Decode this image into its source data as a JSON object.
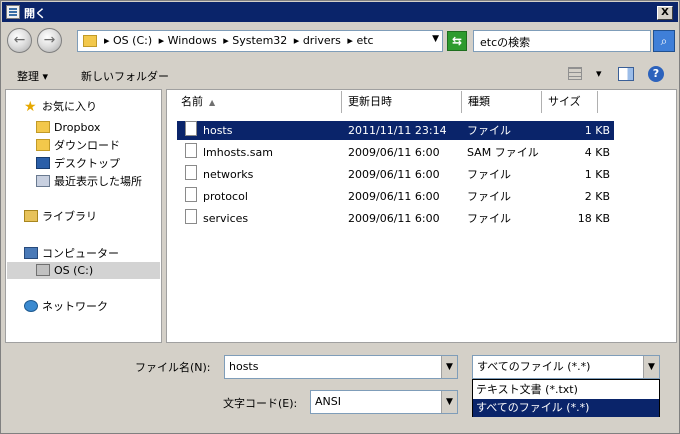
{
  "window": {
    "title": "開く",
    "close_label": "X"
  },
  "nav": {
    "back_label": "←",
    "forward_label": "→",
    "breadcrumbs": [
      "▸ OS (C:)",
      "▸ Windows",
      "▸ System32",
      "▸ drivers",
      "▸ etc"
    ],
    "refresh_label": "⇆",
    "search_placeholder": "etcの検索"
  },
  "toolbar": {
    "organize_label": "整理 ▾",
    "new_folder_label": "新しいフォルダー",
    "views_arrow": "▾",
    "help_label": "?"
  },
  "sidebar": {
    "favorites": "お気に入り",
    "items": [
      "Dropbox",
      "ダウンロード",
      "デスクトップ",
      "最近表示した場所"
    ],
    "libraries": "ライブラリ",
    "computer": "コンピューター",
    "drive": "OS (C:)",
    "network": "ネットワーク"
  },
  "columns": {
    "name": "名前",
    "date": "更新日時",
    "type": "種類",
    "size": "サイズ",
    "sort_arrow": "▲"
  },
  "files": [
    {
      "name": "hosts",
      "date": "2011/11/11 23:14",
      "type": "ファイル",
      "size": "1 KB"
    },
    {
      "name": "lmhosts.sam",
      "date": "2009/06/11 6:00",
      "type": "SAM ファイル",
      "size": "4 KB"
    },
    {
      "name": "networks",
      "date": "2009/06/11 6:00",
      "type": "ファイル",
      "size": "1 KB"
    },
    {
      "name": "protocol",
      "date": "2009/06/11 6:00",
      "type": "ファイル",
      "size": "2 KB"
    },
    {
      "name": "services",
      "date": "2009/06/11 6:00",
      "type": "ファイル",
      "size": "18 KB"
    }
  ],
  "bottom": {
    "filename_label": "ファイル名(N):",
    "filename_value": "hosts",
    "encoding_label": "文字コード(E):",
    "encoding_value": "ANSI",
    "filter_value": "すべてのファイル (*.*)",
    "filter_options": [
      "テキスト文書 (*.txt)",
      "すべてのファイル (*.*)"
    ]
  }
}
